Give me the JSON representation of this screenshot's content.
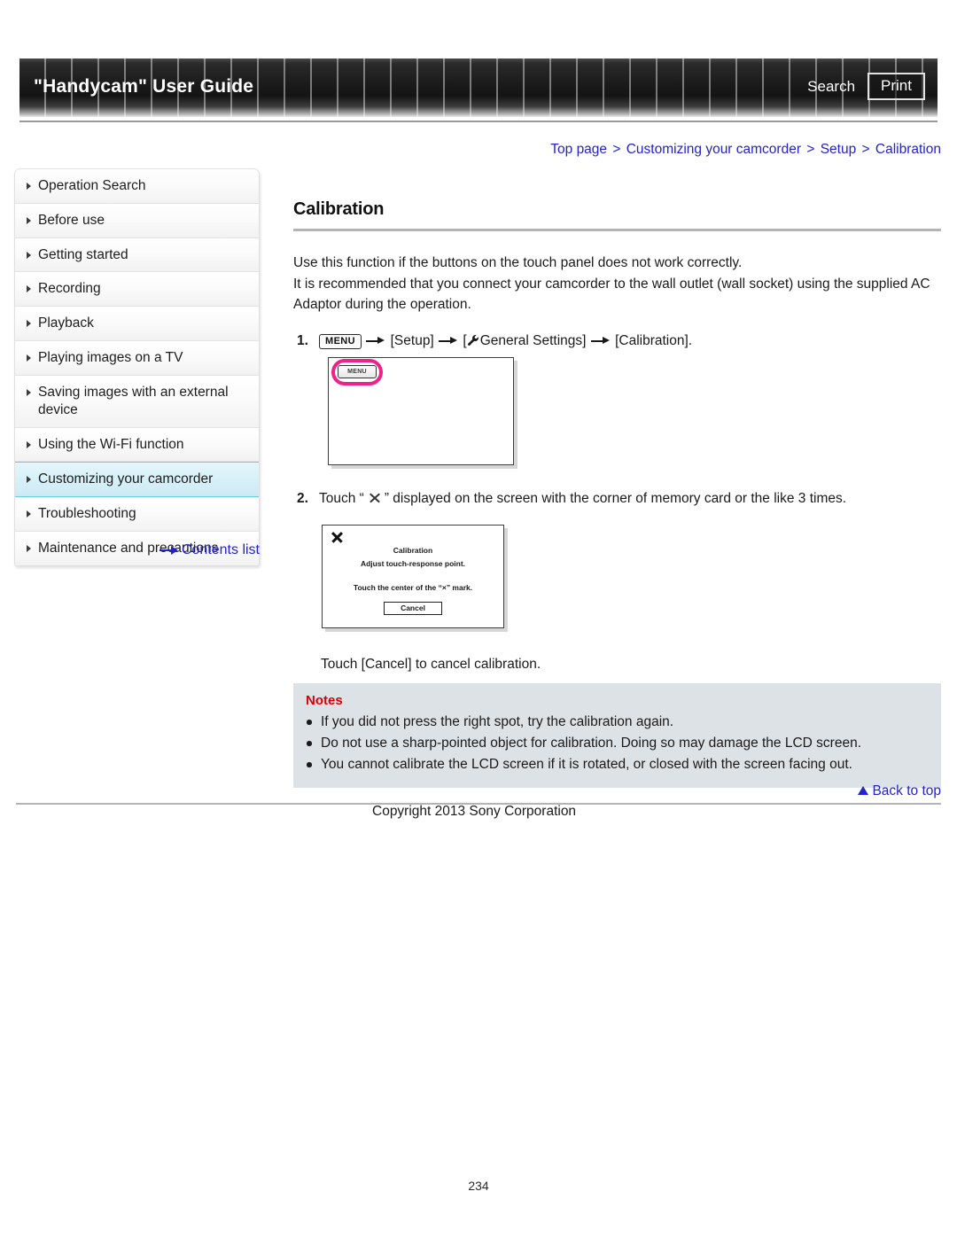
{
  "header": {
    "title": "\"Handycam\" User Guide",
    "search_label": "Search",
    "print_label": "Print"
  },
  "breadcrumb": {
    "items": [
      "Top page",
      "Customizing your camcorder",
      "Setup",
      "Calibration"
    ],
    "separator": ">",
    "full": "Top page > Customizing your camcorder > Setup > Calibration"
  },
  "sidebar": {
    "items": [
      {
        "label": "Operation Search",
        "selected": false
      },
      {
        "label": "Before use",
        "selected": false
      },
      {
        "label": "Getting started",
        "selected": false
      },
      {
        "label": "Recording",
        "selected": false
      },
      {
        "label": "Playback",
        "selected": false
      },
      {
        "label": "Playing images on a TV",
        "selected": false
      },
      {
        "label": "Saving images with an external device",
        "selected": false
      },
      {
        "label": "Using the Wi-Fi function",
        "selected": false
      },
      {
        "label": "Customizing your camcorder",
        "selected": true
      },
      {
        "label": "Troubleshooting",
        "selected": false
      },
      {
        "label": "Maintenance and precautions",
        "selected": false
      }
    ],
    "contents_list_label": "Contents list",
    "highlight_color": "#d6f0f8",
    "highlight_border": "#66ccdd"
  },
  "main": {
    "title": "Calibration",
    "intro_line1": "Use this function if the buttons on the touch panel does not work correctly.",
    "intro_line2": "It is recommended that you connect your camcorder to the wall outlet (wall socket) using the supplied AC Adaptor during the operation.",
    "step1": {
      "number": "1.",
      "menu_chip": "MENU",
      "part_setup": "[Setup]",
      "part_general_open": "[",
      "part_general": "General Settings]",
      "part_calibration": "[Calibration]."
    },
    "step2": {
      "number": "2.",
      "text_before": "Touch “",
      "text_after": "” displayed on the screen with the corner of memory card or the like 3 times."
    },
    "cancel_note": "Touch [Cancel] to cancel calibration."
  },
  "figures": {
    "fig1": {
      "menu_button_label": "MENU",
      "highlight_color": "#ee2288"
    },
    "fig2": {
      "title": "Calibration",
      "line1": "Adjust touch-response point.",
      "line2": "Touch the center of the “×” mark.",
      "cancel_label": "Cancel"
    }
  },
  "notes": {
    "title": "Notes",
    "title_color": "#dd0000",
    "items": [
      "If you did not press the right spot, try the calibration again.",
      "Do not use a sharp-pointed object for calibration. Doing so may damage the LCD screen.",
      "You cannot calibrate the LCD screen if it is rotated, or closed with the screen facing out."
    ]
  },
  "footer": {
    "back_to_top": "Back to top",
    "copyright": "Copyright 2013 Sony Corporation",
    "page_number": "234"
  }
}
